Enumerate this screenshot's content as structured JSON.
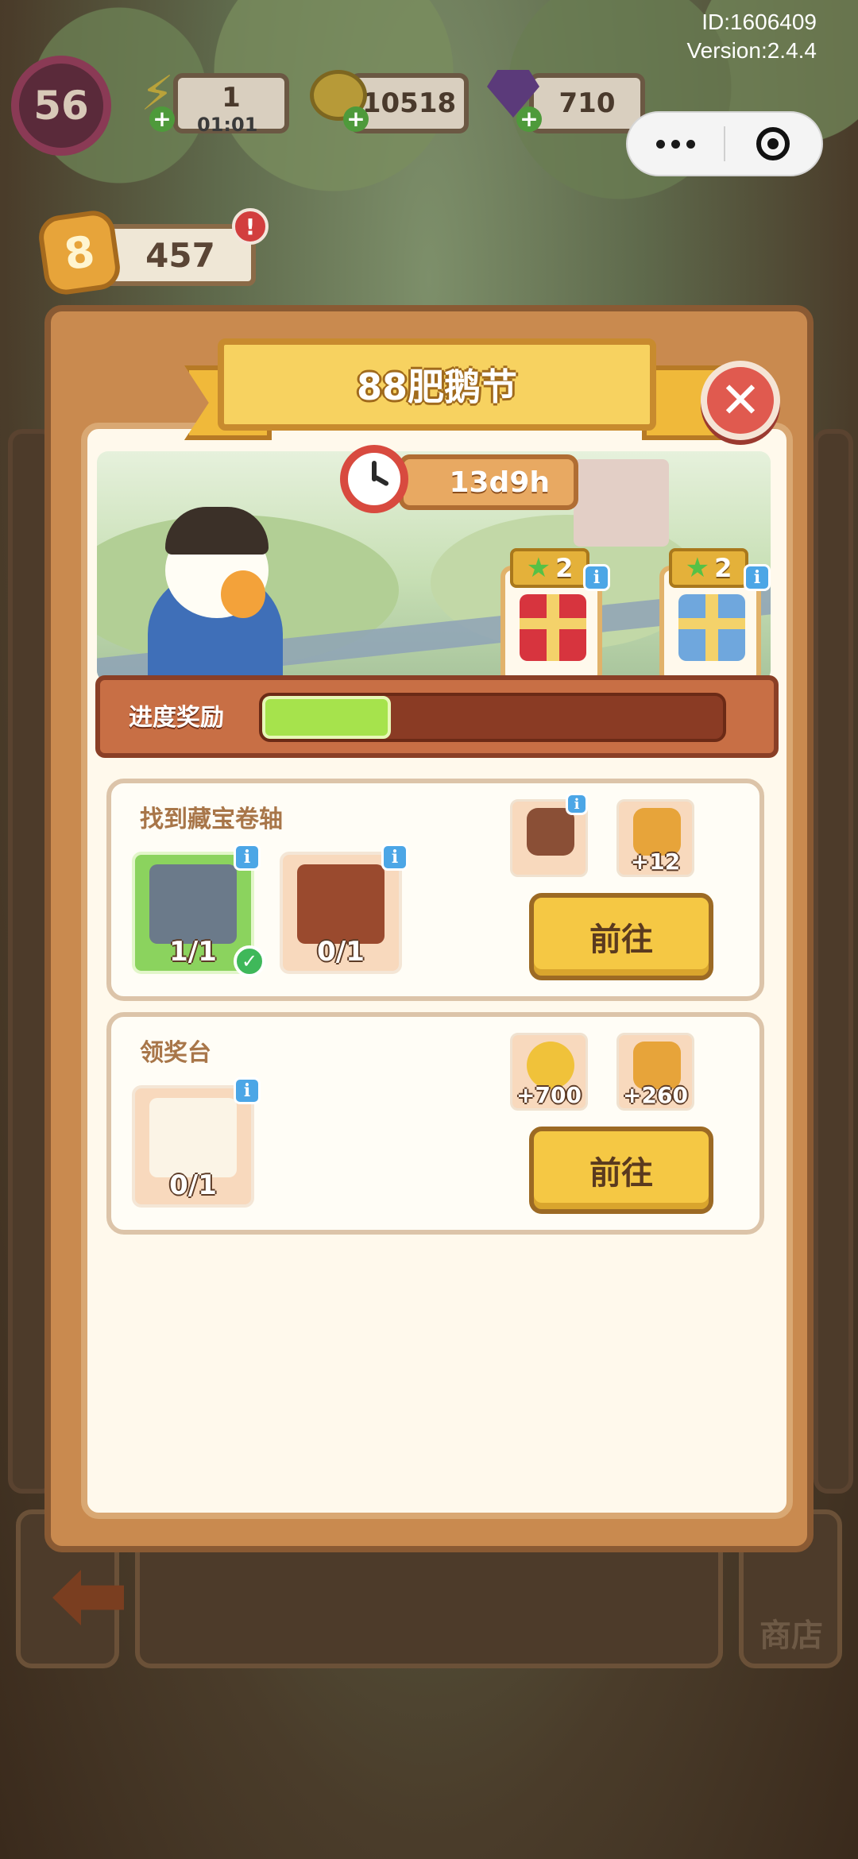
{
  "system": {
    "id_text": "ID:1606409",
    "version_text": "Version:2.4.4"
  },
  "hud": {
    "level": "56",
    "energy": "1",
    "energy_timer": "01:01",
    "coins": "10518",
    "gems": "710",
    "token_count": "457",
    "alert": "!"
  },
  "event": {
    "title": "88肥鹅节",
    "close_glyph": "✕",
    "timer": "13d9h",
    "progress_label": "进度奖励",
    "progress_fraction": 0.28,
    "milestones": [
      {
        "stars": "2",
        "gift": "red"
      },
      {
        "stars": "2",
        "gift": "blue"
      }
    ]
  },
  "tasks": [
    {
      "title": "找到藏宝卷轴",
      "items": [
        {
          "name": "house",
          "count": "1/1",
          "done": true
        },
        {
          "name": "treasure-chest",
          "count": "0/1",
          "done": false
        }
      ],
      "rewards": [
        {
          "name": "wood-fence",
          "amount": ""
        },
        {
          "name": "token",
          "amount": "+12"
        }
      ],
      "button": "前往"
    },
    {
      "title": "领奖台",
      "items": [
        {
          "name": "geese-pair",
          "count": "0/1",
          "done": false
        }
      ],
      "rewards": [
        {
          "name": "coin",
          "amount": "+700"
        },
        {
          "name": "token",
          "amount": "+260"
        }
      ],
      "button": "前往"
    }
  ],
  "background": {
    "shop_label": "商店"
  },
  "colors": {
    "modal_frame": "#c98a4f",
    "panel": "#fff9ec",
    "button": "#f5c844",
    "progress_fill": "#a6e34c",
    "close": "#e05a4f"
  }
}
